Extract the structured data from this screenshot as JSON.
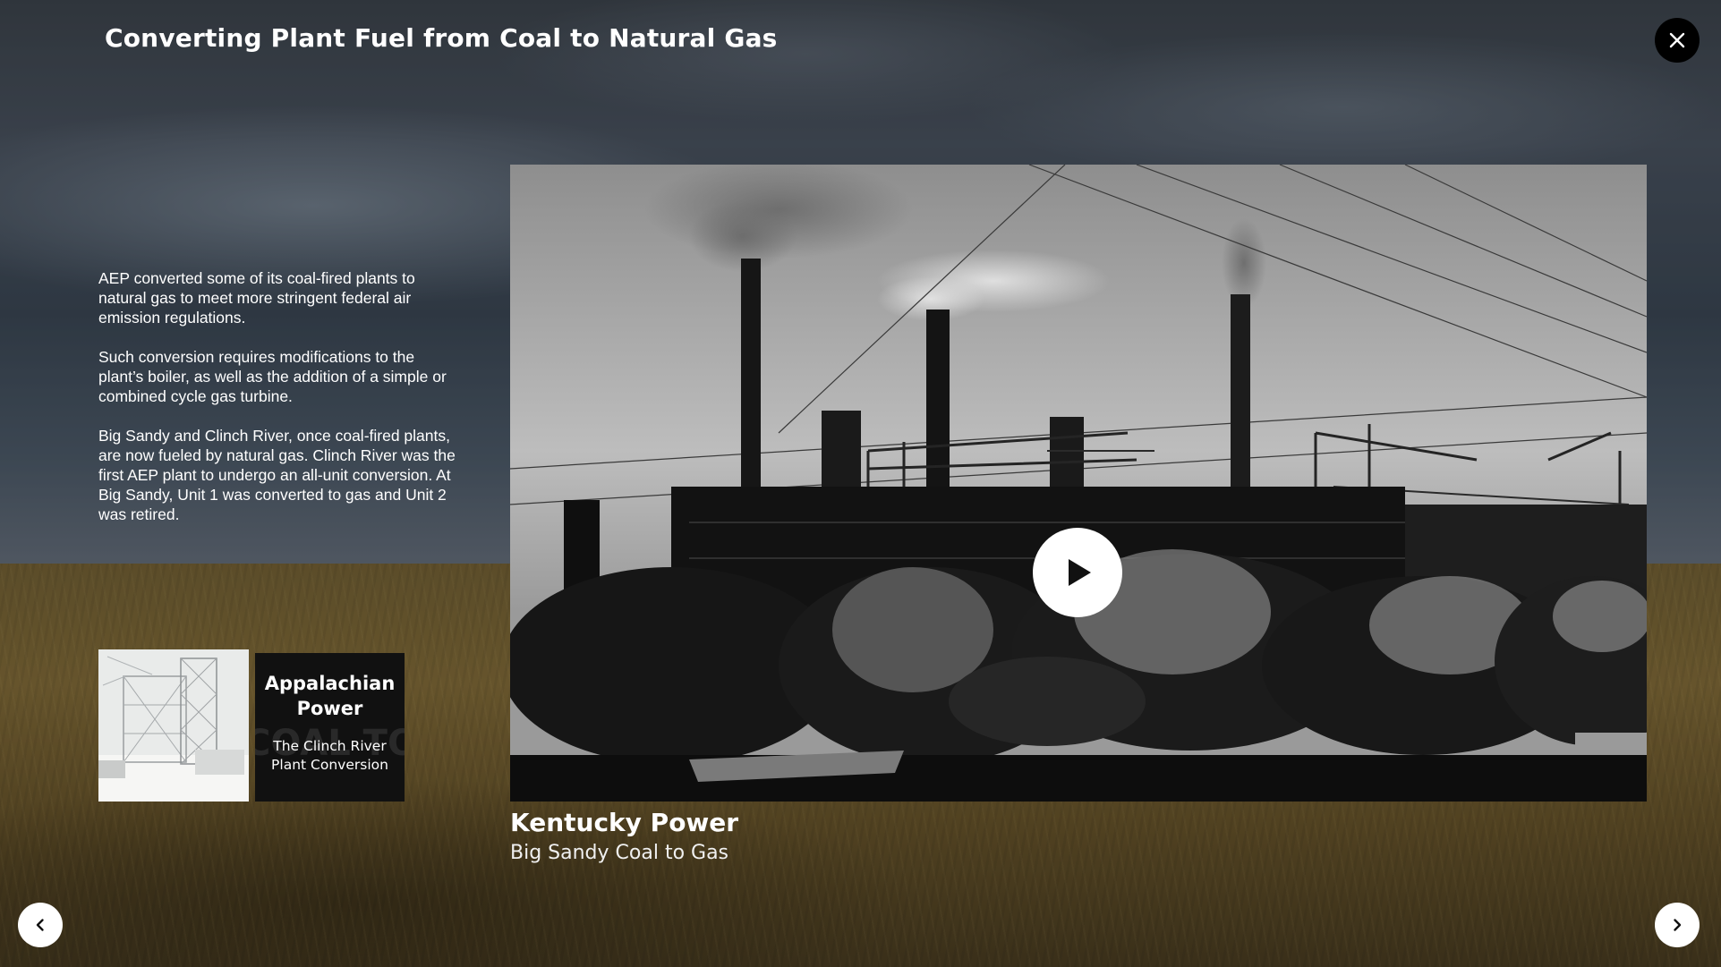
{
  "page": {
    "title": "Converting Plant Fuel from Coal to Natural Gas"
  },
  "description": {
    "paragraphs": [
      "AEP converted some of its coal-fired plants to natural gas to meet more stringent federal air emission regulations.",
      "Such conversion requires modifications to the plant’s boiler, as well as the addition of a simple or combined cycle gas turbine.",
      "Big Sandy and Clinch River, once coal-fired plants, are now fueled by natural gas. Clinch River was the first AEP plant to undergo an all-unit conversion. At Big Sandy, Unit 1 was converted to gas and Unit 2 was retired."
    ]
  },
  "related": {
    "title": "Appalachian Power",
    "subtitle": "The Clinch River Plant Conversion",
    "thumb_overlay": "COAL TO GAS"
  },
  "video": {
    "title": "Kentucky Power",
    "subtitle": "Big Sandy Coal to Gas",
    "play_icon": "play-icon"
  },
  "controls": {
    "close_icon": "close-icon",
    "prev_icon": "chevron-left-icon",
    "next_icon": "chevron-right-icon"
  },
  "colors": {
    "overlay_button": "#000000",
    "nav_button": "#ffffff",
    "text": "#ffffff"
  }
}
